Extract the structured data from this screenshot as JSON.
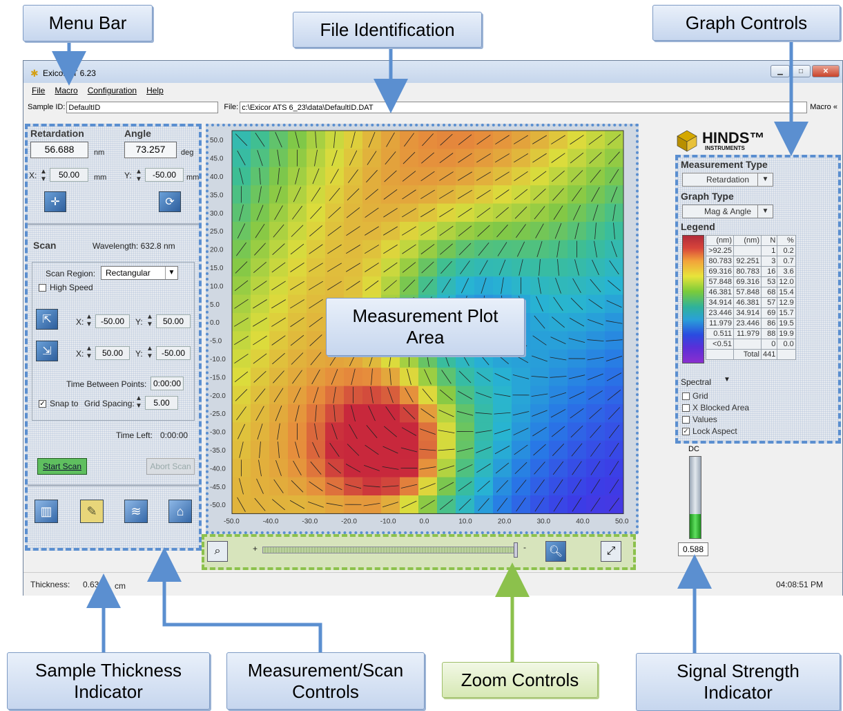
{
  "window": {
    "title": "Exicor AT 6.23",
    "controls": [
      "minimize",
      "maximize",
      "close"
    ]
  },
  "menu": [
    "File",
    "Macro",
    "Configuration",
    "Help"
  ],
  "filebar": {
    "sample_id_label": "Sample ID:",
    "sample_id": "DefaultID",
    "file_label": "File:",
    "file_path": "c:\\Exicor ATS 6_23\\data\\DefaultID.DAT",
    "macro_label": "Macro «"
  },
  "measurement": {
    "retardation_label": "Retardation",
    "retardation_value": "56.688",
    "retardation_unit": "nm",
    "angle_label": "Angle",
    "angle_value": "73.257",
    "angle_unit": "deg",
    "x_label": "X:",
    "x_value": "50.00",
    "x_unit": "mm",
    "y_label": "Y:",
    "y_value": "-50.00",
    "y_unit": "mm"
  },
  "scan": {
    "title": "Scan",
    "wavelength": "Wavelength: 632.8 nm",
    "region_label": "Scan Region:",
    "region_value": "Rectangular",
    "high_speed_label": "High Speed",
    "start_x": "-50.00",
    "start_y": "50.00",
    "end_x": "50.00",
    "end_y": "-50.00",
    "x_label": "X:",
    "y_label": "Y:",
    "time_between_label": "Time Between Points:",
    "time_between_value": "0:00:00",
    "snap_label": "Snap to",
    "grid_spacing_label": "Grid Spacing:",
    "grid_spacing_value": "5.00",
    "time_left_label": "Time Left:",
    "time_left_value": "0:00:00",
    "start_button": "Start Scan",
    "abort_button": "Abort Scan"
  },
  "plot": {
    "y_ticks": [
      "50.0",
      "45.0",
      "40.0",
      "35.0",
      "30.0",
      "25.0",
      "20.0",
      "15.0",
      "10.0",
      "5.0",
      "0.0",
      "-5.0",
      "-10.0",
      "-15.0",
      "-20.0",
      "-25.0",
      "-30.0",
      "-35.0",
      "-40.0",
      "-45.0",
      "-50.0"
    ],
    "x_ticks": [
      "-50.0",
      "-40.0",
      "-30.0",
      "-20.0",
      "-10.0",
      "0.0",
      "10.0",
      "20.0",
      "30.0",
      "40.0",
      "50.0"
    ]
  },
  "graph_controls": {
    "logo": "HINDS™",
    "logo_sub": "INSTRUMENTS",
    "measurement_type_label": "Measurement Type",
    "measurement_type": "Retardation",
    "graph_type_label": "Graph Type",
    "graph_type": "Mag & Angle",
    "legend_label": "Legend",
    "legend_header": [
      "(nm)",
      "(nm)",
      "N",
      "%"
    ],
    "legend_rows": [
      [
        ">92.25",
        "",
        "1",
        "0.2"
      ],
      [
        "80.783",
        "92.251",
        "3",
        "0.7"
      ],
      [
        "69.316",
        "80.783",
        "16",
        "3.6"
      ],
      [
        "57.848",
        "69.316",
        "53",
        "12.0"
      ],
      [
        "46.381",
        "57.848",
        "68",
        "15.4"
      ],
      [
        "34.914",
        "46.381",
        "57",
        "12.9"
      ],
      [
        "23.446",
        "34.914",
        "69",
        "15.7"
      ],
      [
        "11.979",
        "23.446",
        "86",
        "19.5"
      ],
      [
        "0.511",
        "11.979",
        "88",
        "19.9"
      ],
      [
        "<0.51",
        "",
        "0",
        "0.0"
      ],
      [
        "",
        "Total",
        "441",
        ""
      ]
    ],
    "palette": "Spectral",
    "checks": [
      {
        "label": "Grid",
        "checked": false
      },
      {
        "label": "X Blocked Area",
        "checked": false
      },
      {
        "label": "Values",
        "checked": false
      },
      {
        "label": "Lock Aspect",
        "checked": true
      }
    ]
  },
  "signal": {
    "label": "DC",
    "value": "0.588",
    "level_fraction": 0.3
  },
  "status": {
    "thickness_label": "Thickness:",
    "thickness_value": "0.630",
    "thickness_unit": "cm",
    "time": "04:08:51 PM"
  },
  "callouts": {
    "menu_bar": "Menu Bar",
    "file_identification": "File Identification",
    "graph_controls": "Graph Controls",
    "measurement_plot_area": "Measurement Plot Area",
    "sample_thickness": "Sample Thickness Indicator",
    "measurement_scan_controls": "Measurement/Scan Controls",
    "zoom_controls": "Zoom Controls",
    "signal_strength": "Signal Strength Indicator"
  }
}
